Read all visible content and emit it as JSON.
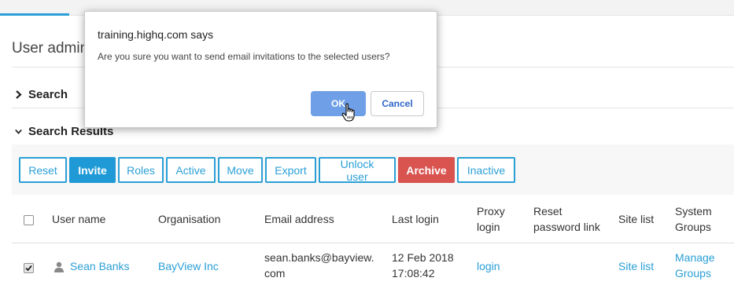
{
  "page": {
    "title": "User admin"
  },
  "sections": {
    "search": "Search",
    "results": "Search Results"
  },
  "toolbar": {
    "buttons": [
      "Reset",
      "Invite",
      "Roles",
      "Active",
      "Move",
      "Export",
      "Unlock user",
      "Archive",
      "Inactive"
    ],
    "active": "Invite",
    "danger": "Archive"
  },
  "table": {
    "headers": {
      "username": "User name",
      "organisation": "Organisation",
      "email": "Email address",
      "last_login_1": "Last login",
      "proxy_1": "Proxy",
      "proxy_2": "login",
      "reset_1": "Reset",
      "reset_2": "password link",
      "site_list": "Site list",
      "groups_1": "System",
      "groups_2": "Groups"
    },
    "rows": [
      {
        "checked": true,
        "username": "Sean Banks",
        "organisation": "BayView Inc",
        "email_1": "sean.banks@bayview.",
        "email_2": "com",
        "last_login_1": "12 Feb 2018",
        "last_login_2": "17:08:42",
        "proxy": "login",
        "site_list": "Site list",
        "groups_1": "Manage",
        "groups_2": "Groups"
      }
    ]
  },
  "dialog": {
    "title": "training.highq.com says",
    "message": "Are you sure you want to send email invitations to the selected users?",
    "ok": "OK",
    "cancel": "Cancel"
  },
  "colors": {
    "accent": "#2a9fd6",
    "danger": "#d9534f",
    "dialog_ok": "#6f9fe6"
  }
}
